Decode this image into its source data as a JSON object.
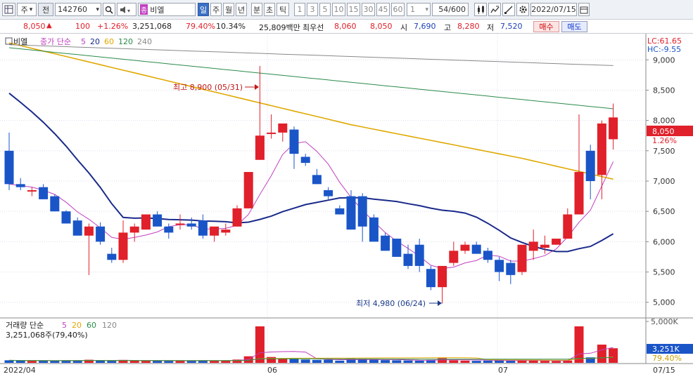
{
  "toolbar": {
    "grid_icon": "grid-icon",
    "market": "주",
    "market_chevron": "▾",
    "fullname_btn": "전",
    "code": "142760",
    "stock_name": "비엘",
    "period": {
      "day": "일",
      "week": "주",
      "month": "월",
      "year": "년",
      "minute": "분",
      "sec": "초",
      "tick": "틱"
    },
    "intervals": [
      "1",
      "3",
      "5",
      "10",
      "15",
      "30",
      "45",
      "60"
    ],
    "custom_interval": "1",
    "count": "54/600",
    "date": "2022/07/15",
    "name_badge": "종"
  },
  "quote": {
    "price": "8,050",
    "arrow": "▲",
    "change": "100",
    "change_pct": "+1.26%",
    "volume": "3,251,068",
    "volume_ratio": "79.40%",
    "turnover": "10.34%",
    "amount": "25,809백만",
    "best_bid_label": "최우선",
    "best_ask": "8,060",
    "best_bid": "8,050",
    "open_label": "시",
    "open": "7,690",
    "high_label": "고",
    "high": "8,280",
    "low_label": "저",
    "low": "7,520",
    "buy": "매수",
    "sell": "매도"
  },
  "chart_legend": {
    "label": "비엘",
    "series_label": "종가 단순",
    "periods": [
      "5",
      "20",
      "60",
      "120",
      "240"
    ]
  },
  "volume_legend": {
    "label": "거래량 단순",
    "periods": [
      "5",
      "20",
      "60",
      "120"
    ],
    "value": "3,251,068주(79,40%)"
  },
  "right_axis": {
    "lc": "LC:61.65",
    "hc": "HC:-9.55",
    "ticks": [
      "9,000",
      "8,500",
      "8,000",
      "7,500",
      "7,000",
      "6,500",
      "6,000",
      "5,500",
      "5,000"
    ],
    "price_tag": "8,050",
    "pct_tag": "1.26%",
    "vol_tick": "5,000K",
    "vol_tag": "3,251K",
    "vol_pct": "79.40%"
  },
  "annotations": {
    "high": "최고 8,900 (05/31)",
    "low": "최저 4,980 (06/24)"
  },
  "date_axis": [
    "2022/04",
    "06",
    "07",
    "07/15"
  ],
  "colors": {
    "up": "#e0202a",
    "down": "#1a55c8",
    "ma5": "#c040c0",
    "ma20": "#1a2a8a",
    "ma60": "#e0a800",
    "ma120": "#2a8a4a",
    "ma240": "#888"
  },
  "chart_data": {
    "type": "candlestick",
    "ylim": [
      4800,
      9600
    ],
    "candles": [
      [
        7500,
        7800,
        6850,
        6950
      ],
      [
        6950,
        7050,
        6850,
        6900
      ],
      [
        6850,
        6900,
        6750,
        6850
      ],
      [
        6900,
        6950,
        6700,
        6700
      ],
      [
        6750,
        6780,
        6500,
        6500
      ],
      [
        6500,
        6520,
        6300,
        6300
      ],
      [
        6350,
        6400,
        6150,
        6100
      ],
      [
        6100,
        6300,
        5450,
        6250
      ],
      [
        6250,
        6320,
        5950,
        6000
      ],
      [
        5800,
        5900,
        5650,
        5700
      ],
      [
        5700,
        6350,
        5650,
        6150
      ],
      [
        6150,
        6300,
        6000,
        6250
      ],
      [
        6200,
        6450,
        6200,
        6450
      ],
      [
        6450,
        6500,
        6300,
        6250
      ],
      [
        6250,
        6300,
        6050,
        6150
      ],
      [
        6300,
        6450,
        6200,
        6300
      ],
      [
        6300,
        6400,
        6200,
        6250
      ],
      [
        6350,
        6450,
        6050,
        6100
      ],
      [
        6100,
        6200,
        6000,
        6250
      ],
      [
        6150,
        6300,
        6100,
        6200
      ],
      [
        6250,
        6600,
        6250,
        6550
      ],
      [
        6550,
        6950,
        6550,
        7150
      ],
      [
        7350,
        8900,
        7350,
        7750
      ],
      [
        7800,
        8100,
        7700,
        7800
      ],
      [
        7800,
        7950,
        7650,
        7950
      ],
      [
        7850,
        7900,
        7200,
        7450
      ],
      [
        7400,
        7450,
        7250,
        7300
      ],
      [
        7100,
        7200,
        6950,
        6950
      ],
      [
        6850,
        6900,
        6700,
        6750
      ],
      [
        6550,
        6600,
        6450,
        6450
      ],
      [
        6750,
        6850,
        6200,
        6200
      ],
      [
        6750,
        6800,
        6000,
        6250
      ],
      [
        6400,
        6450,
        6050,
        6000
      ],
      [
        6100,
        6150,
        5850,
        5850
      ],
      [
        6050,
        6050,
        5750,
        5750
      ],
      [
        5800,
        5950,
        5550,
        5600
      ],
      [
        5950,
        6050,
        5500,
        5600
      ],
      [
        5550,
        5600,
        5200,
        5250
      ],
      [
        5250,
        5600,
        4980,
        5600
      ],
      [
        5650,
        6000,
        5600,
        5850
      ],
      [
        5850,
        6000,
        5800,
        5950
      ],
      [
        5950,
        6000,
        5800,
        5800
      ],
      [
        5850,
        5900,
        5650,
        5700
      ],
      [
        5700,
        5750,
        5350,
        5500
      ],
      [
        5650,
        5700,
        5300,
        5450
      ],
      [
        5500,
        5900,
        5450,
        5950
      ],
      [
        5850,
        6200,
        5700,
        6000
      ],
      [
        5900,
        6100,
        5800,
        5950
      ],
      [
        5950,
        6050,
        5950,
        6050
      ],
      [
        6050,
        6550,
        6050,
        6450
      ],
      [
        6450,
        8100,
        6450,
        7150
      ],
      [
        7500,
        7600,
        6700,
        7000
      ],
      [
        7100,
        8000,
        6700,
        7950
      ],
      [
        7690,
        8280,
        7520,
        8050
      ]
    ],
    "volumes": [
      70,
      60,
      55,
      60,
      55,
      70,
      65,
      85,
      60,
      55,
      80,
      60,
      55,
      60,
      50,
      60,
      55,
      70,
      55,
      60,
      90,
      180,
      1000,
      160,
      110,
      120,
      90,
      80,
      85,
      60,
      120,
      110,
      85,
      75,
      70,
      65,
      60,
      80,
      130,
      70,
      60,
      55,
      60,
      80,
      60,
      75,
      60,
      55,
      50,
      65,
      1000,
      150,
      500,
      400
    ]
  }
}
